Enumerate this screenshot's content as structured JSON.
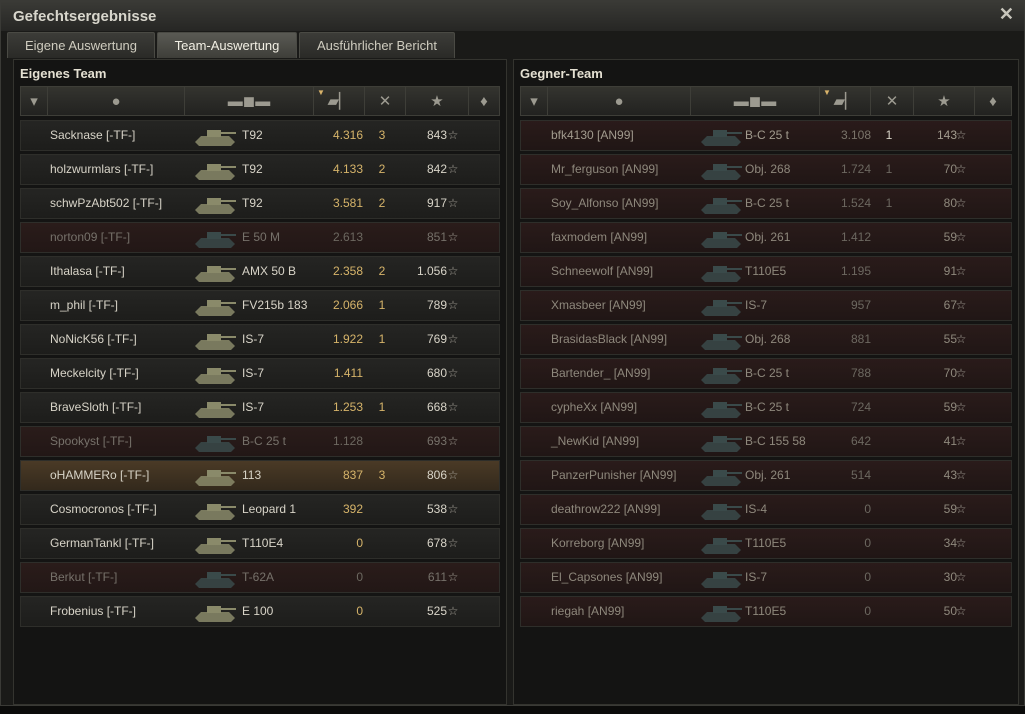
{
  "window": {
    "title": "Gefechtsergebnisse",
    "close_glyph": "✕"
  },
  "tabs": [
    {
      "label": "Eigene Auswertung"
    },
    {
      "label": "Team-Auswertung"
    },
    {
      "label": "Ausführlicher Bericht"
    }
  ],
  "own_team": {
    "title": "Eigenes Team",
    "rows": [
      {
        "name": "Sacknase [-TF-]",
        "tank": "T92",
        "damage": "4.316",
        "kills": "3",
        "xp": "843",
        "status": "alive"
      },
      {
        "name": "holzwurmlars [-TF-]",
        "tank": "T92",
        "damage": "4.133",
        "kills": "2",
        "xp": "842",
        "status": "alive"
      },
      {
        "name": "schwPzAbt502 [-TF-]",
        "tank": "T92",
        "damage": "3.581",
        "kills": "2",
        "xp": "917",
        "status": "alive"
      },
      {
        "name": "norton09 [-TF-]",
        "tank": "E 50 M",
        "damage": "2.613",
        "kills": "",
        "xp": "851",
        "status": "dead"
      },
      {
        "name": "Ithalasa [-TF-]",
        "tank": "AMX 50 B",
        "damage": "2.358",
        "kills": "2",
        "xp": "1.056",
        "status": "alive"
      },
      {
        "name": "m_phil [-TF-]",
        "tank": "FV215b 183",
        "damage": "2.066",
        "kills": "1",
        "xp": "789",
        "status": "alive"
      },
      {
        "name": "NoNicK56 [-TF-]",
        "tank": "IS-7",
        "damage": "1.922",
        "kills": "1",
        "xp": "769",
        "status": "alive"
      },
      {
        "name": "Meckelcity [-TF-]",
        "tank": "IS-7",
        "damage": "1.411",
        "kills": "",
        "xp": "680",
        "status": "alive"
      },
      {
        "name": "BraveSloth [-TF-]",
        "tank": "IS-7",
        "damage": "1.253",
        "kills": "1",
        "xp": "668",
        "status": "alive"
      },
      {
        "name": "Spookyst [-TF-]",
        "tank": "B-C 25 t",
        "damage": "1.128",
        "kills": "",
        "xp": "693",
        "status": "dead"
      },
      {
        "name": "oHAMMERo [-TF-]",
        "tank": "113",
        "damage": "837",
        "kills": "3",
        "xp": "806",
        "status": "self"
      },
      {
        "name": "Cosmocronos [-TF-]",
        "tank": "Leopard 1",
        "damage": "392",
        "kills": "",
        "xp": "538",
        "status": "alive"
      },
      {
        "name": "GermanTankl [-TF-]",
        "tank": "T110E4",
        "damage": "0",
        "kills": "",
        "xp": "678",
        "status": "alive"
      },
      {
        "name": "Berkut [-TF-]",
        "tank": "T-62A",
        "damage": "0",
        "kills": "",
        "xp": "611",
        "status": "dead"
      },
      {
        "name": "Frobenius [-TF-]",
        "tank": "E 100",
        "damage": "0",
        "kills": "",
        "xp": "525",
        "status": "alive"
      }
    ]
  },
  "enemy_team": {
    "title": "Gegner-Team",
    "rows": [
      {
        "name": "bfk4130 [AN99]",
        "tank": "B-C 25 t",
        "damage": "3.108",
        "kills": "1",
        "xp": "143",
        "status": "alive"
      },
      {
        "name": "Mr_ferguson [AN99]",
        "tank": "Obj. 268",
        "damage": "1.724",
        "kills": "1",
        "xp": "70",
        "status": "dead"
      },
      {
        "name": "Soy_Alfonso [AN99]",
        "tank": "B-C 25 t",
        "damage": "1.524",
        "kills": "1",
        "xp": "80",
        "status": "dead"
      },
      {
        "name": "faxmodem [AN99]",
        "tank": "Obj. 261",
        "damage": "1.412",
        "kills": "",
        "xp": "59",
        "status": "dead"
      },
      {
        "name": "Schneewolf [AN99]",
        "tank": "T110E5",
        "damage": "1.195",
        "kills": "",
        "xp": "91",
        "status": "dead"
      },
      {
        "name": "Xmasbeer [AN99]",
        "tank": "IS-7",
        "damage": "957",
        "kills": "",
        "xp": "67",
        "status": "dead"
      },
      {
        "name": "BrasidasBlack [AN99]",
        "tank": "Obj. 268",
        "damage": "881",
        "kills": "",
        "xp": "55",
        "status": "dead"
      },
      {
        "name": "Bartender_ [AN99]",
        "tank": "B-C 25 t",
        "damage": "788",
        "kills": "",
        "xp": "70",
        "status": "dead"
      },
      {
        "name": "cypheXx [AN99]",
        "tank": "B-C 25 t",
        "damage": "724",
        "kills": "",
        "xp": "59",
        "status": "dead"
      },
      {
        "name": "_NewKid [AN99]",
        "tank": "B-C 155 58",
        "damage": "642",
        "kills": "",
        "xp": "41",
        "status": "dead"
      },
      {
        "name": "PanzerPunisher [AN99]",
        "tank": "Obj. 261",
        "damage": "514",
        "kills": "",
        "xp": "43",
        "status": "dead"
      },
      {
        "name": "deathrow222 [AN99]",
        "tank": "IS-4",
        "damage": "0",
        "kills": "",
        "xp": "59",
        "status": "dead"
      },
      {
        "name": "Korreborg [AN99]",
        "tank": "T110E5",
        "damage": "0",
        "kills": "",
        "xp": "34",
        "status": "dead"
      },
      {
        "name": "El_Capsones [AN99]",
        "tank": "IS-7",
        "damage": "0",
        "kills": "",
        "xp": "30",
        "status": "dead"
      },
      {
        "name": "riegah [AN99]",
        "tank": "T110E5",
        "damage": "0",
        "kills": "",
        "xp": "50",
        "status": "dead"
      }
    ]
  },
  "icons": {
    "tier_col": "tier-badge-icon",
    "player_col": "player-icon",
    "vehicle_col": "tank-icon",
    "damage_col": "damage-icon",
    "kills_col": "destroyed-tanks-icon",
    "xp_col": "star-icon",
    "medal_col": "medal-icon",
    "star_glyph": "☆"
  }
}
